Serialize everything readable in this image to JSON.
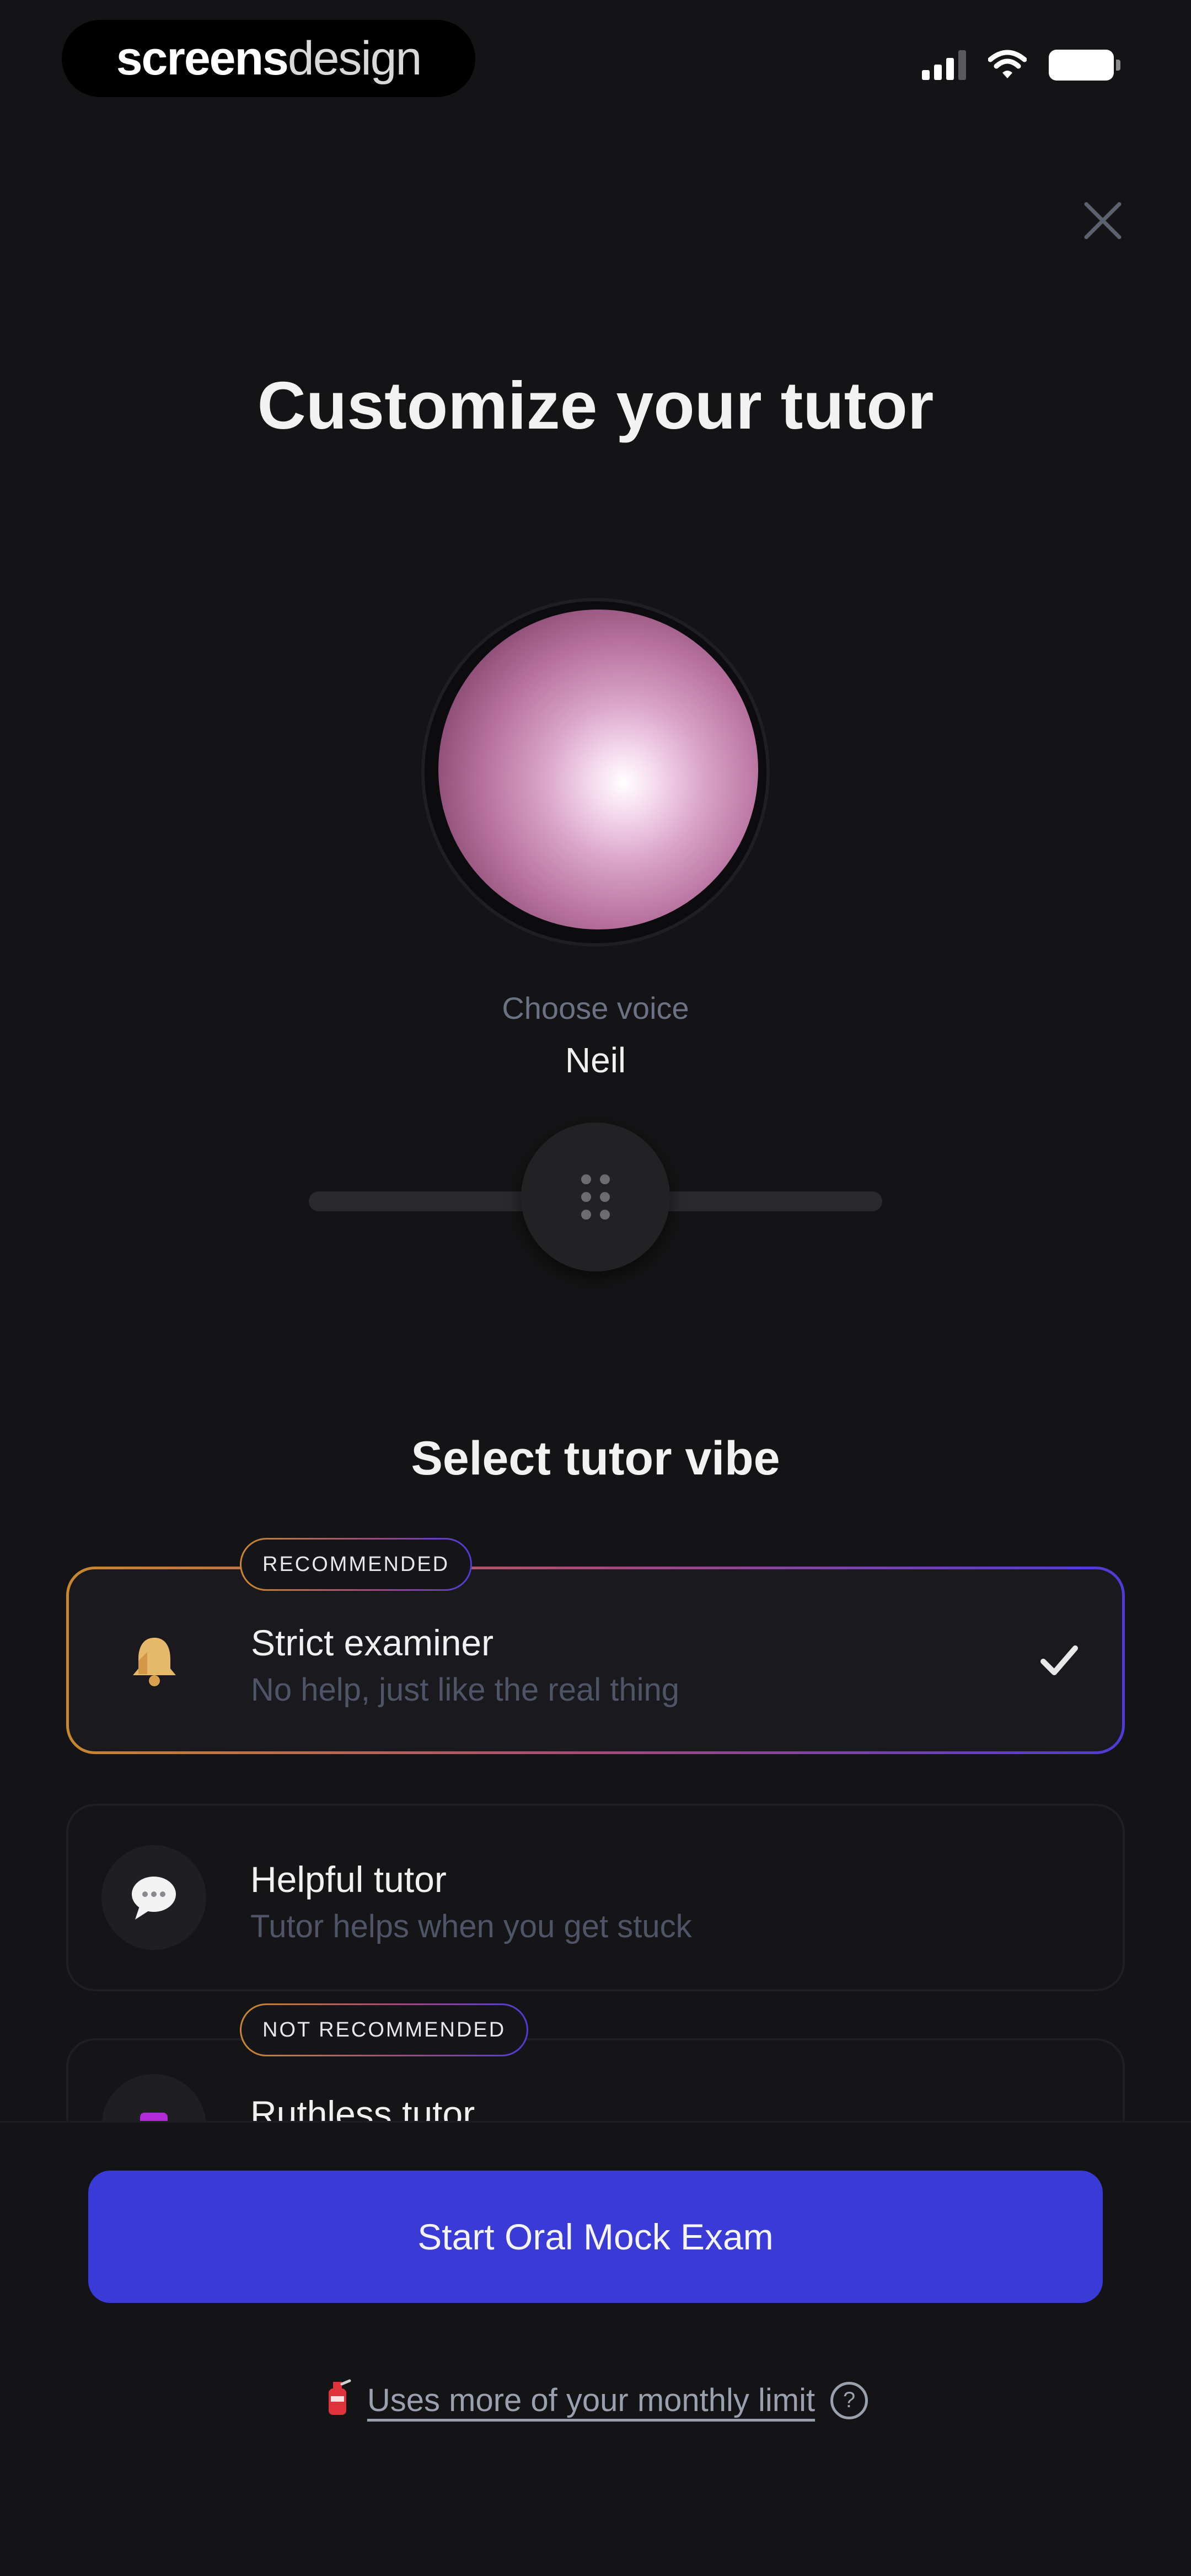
{
  "status_bar": {
    "brand_bold": "screens",
    "brand_light": "design"
  },
  "header": {
    "title": "Customize your tutor",
    "close_icon": "close-icon"
  },
  "voice": {
    "label": "Choose voice",
    "value": "Neil",
    "slider_level": 0.5
  },
  "vibe": {
    "title": "Select tutor vibe",
    "options": [
      {
        "badge": "RECOMMENDED",
        "title": "Strict examiner",
        "subtitle": "No help, just like the real thing",
        "icon": "bell-icon",
        "selected": true
      },
      {
        "title": "Helpful tutor",
        "subtitle": "Tutor helps when you get stuck",
        "icon": "speech-bubble-icon",
        "selected": false
      },
      {
        "badge": "NOT RECOMMENDED",
        "title": "Ruthless tutor",
        "subtitle": "",
        "icon": "purple-square-icon",
        "selected": false
      }
    ]
  },
  "footer": {
    "cta_label": "Start Oral Mock Exam",
    "limit_text": "Uses more of your monthly limit",
    "limit_icon": "fire-extinguisher-icon",
    "help_icon": "question-circle-icon"
  },
  "colors": {
    "background": "#141416",
    "accent": "#3a3ad6",
    "gradient_start": "#c9872e",
    "gradient_end": "#4e3bd8",
    "orb": "#c98bb6"
  }
}
